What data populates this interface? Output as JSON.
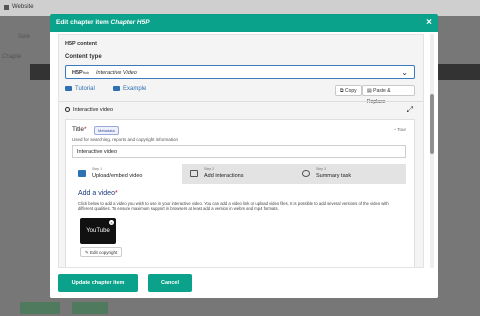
{
  "background": {
    "app_title": "Website",
    "labels": [
      "Sele",
      "Chapte"
    ]
  },
  "modal": {
    "title_prefix": "Edit chapter item",
    "title_item": "Chapter H5P",
    "close": "×",
    "section_label": "H5P content",
    "content_type_label": "Content type",
    "content_type_logo": "H5P",
    "content_type_logo_sub": "Hub",
    "content_type_value": "Interactive Video",
    "toolbar": {
      "tutorial": "Tutorial",
      "example": "Example",
      "copy": "Copy",
      "paste": "Paste & Replace"
    },
    "library_title": "Interactive video",
    "field_title_label": "Title",
    "field_title_badge": "Metadata",
    "tour_label": "Tour",
    "field_title_hint": "Used for searching, reports and copyright information",
    "field_title_value": "Interactive video",
    "tabs": [
      {
        "step": "Step 1",
        "name": "Upload/embed video"
      },
      {
        "step": "Step 2",
        "name": "Add interactions"
      },
      {
        "step": "Step 3",
        "name": "Summary task"
      }
    ],
    "add_video_label": "Add a video",
    "add_video_desc": "Click below to add a video you wish to use in your interactive video. You can add a video link or upload video files. It is possible to add several versions of the video with different qualities. To ensure maximum support in browsers at least add a version in webm and mp4 formats.",
    "video_thumb_label": "YouTube",
    "edit_copyright": "Edit copyright",
    "footer": {
      "update": "Update chapter item",
      "cancel": "Cancel"
    }
  },
  "colors": {
    "accent": "#0aa28a",
    "link": "#2f6fb3",
    "required": "#c8102e"
  }
}
